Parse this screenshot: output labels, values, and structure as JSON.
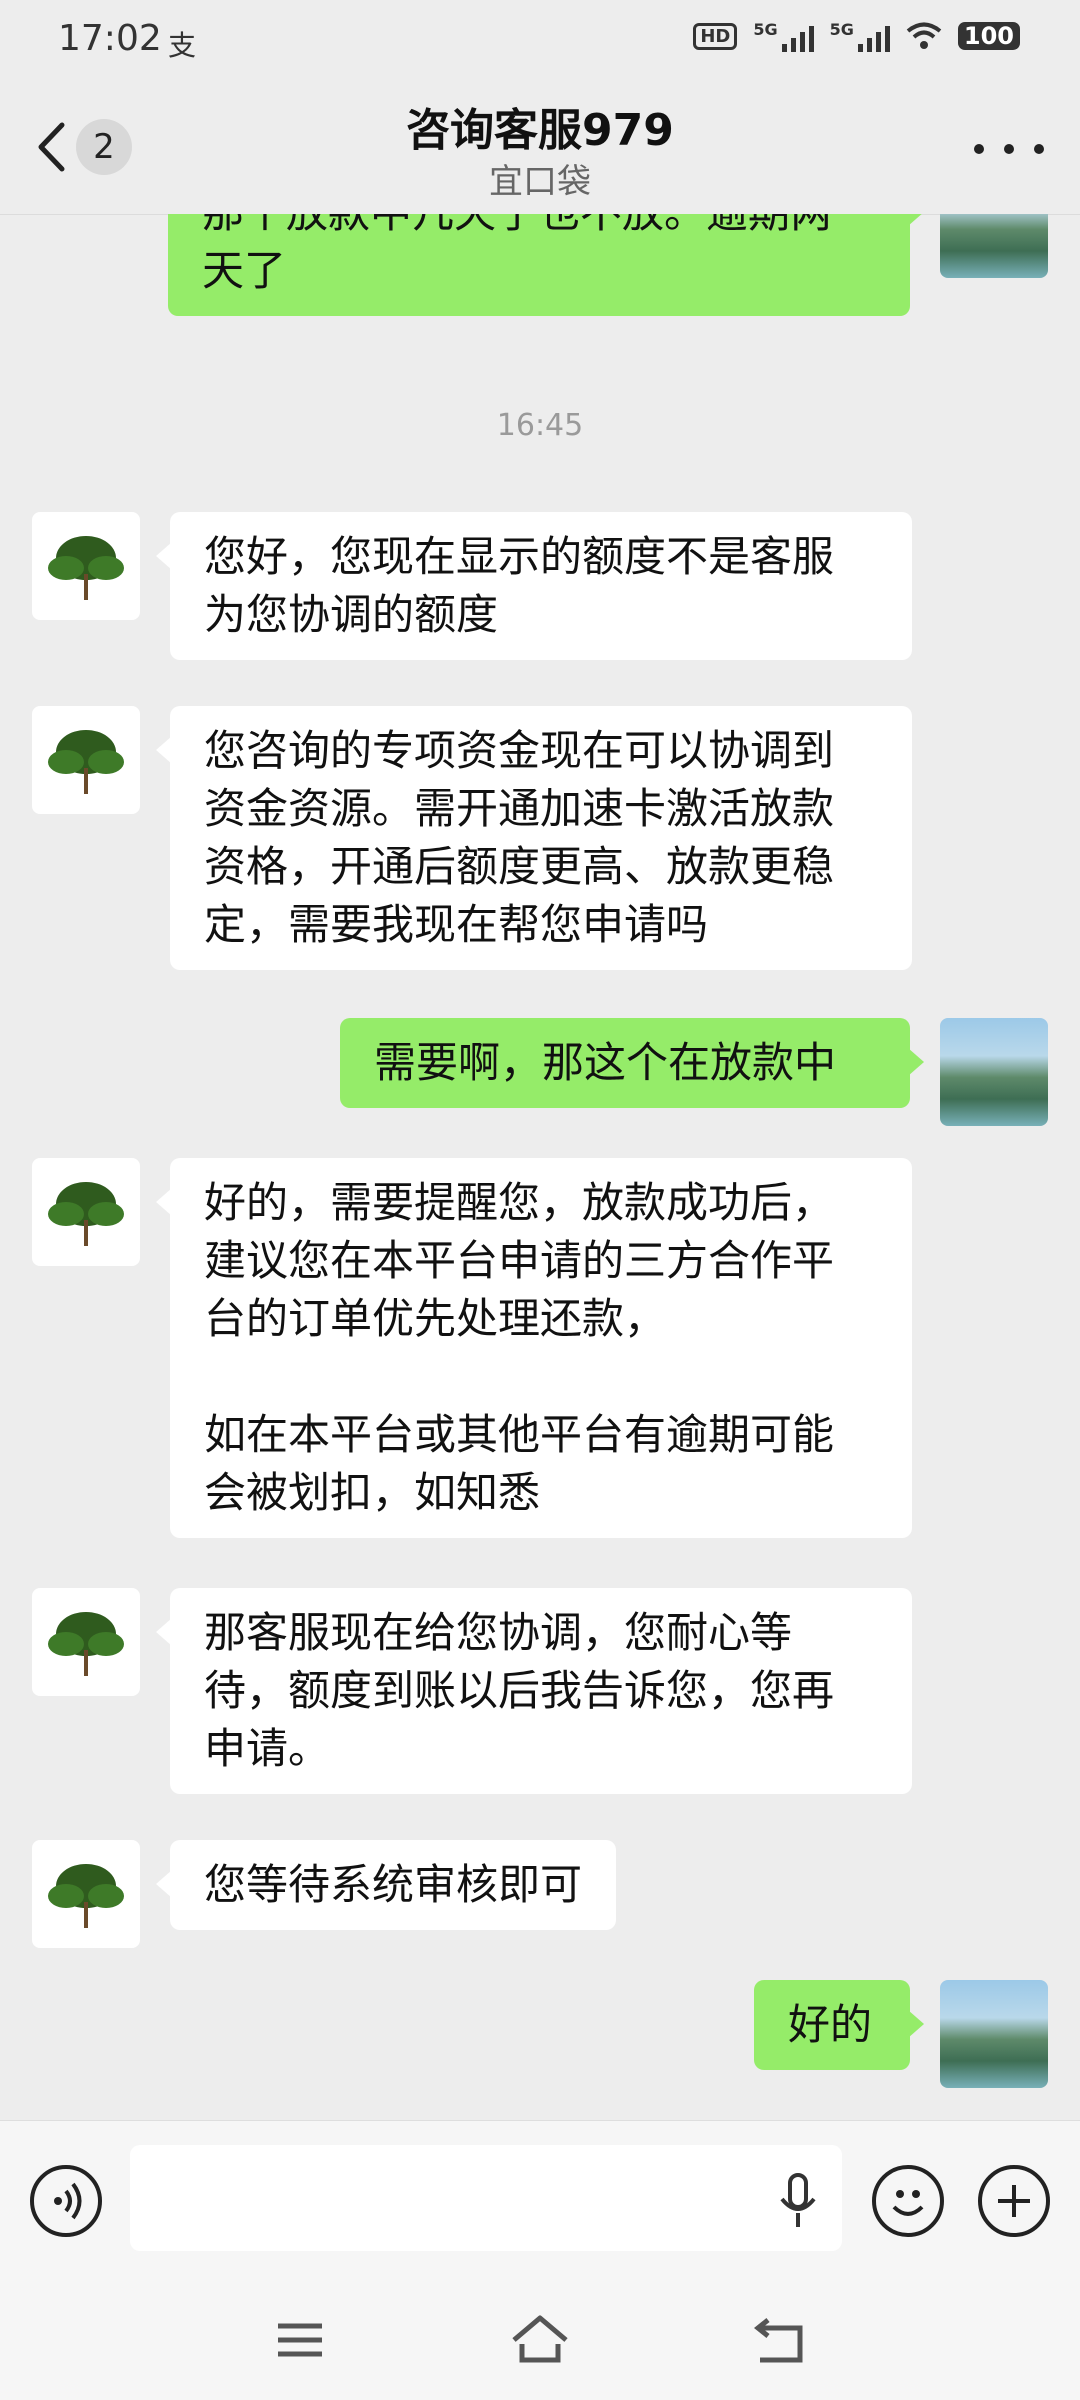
{
  "status_bar": {
    "time": "17:02",
    "alipay_glyph": "支",
    "hd": "HD",
    "sim1": "5G",
    "sim2": "5G",
    "battery": "100"
  },
  "header": {
    "unread_count": "2",
    "title": "咨询客服979",
    "subtitle": "宜口袋",
    "back_icon": "chevron-left-icon",
    "more_icon": "more-dots-icon"
  },
  "colors": {
    "background": "#ededed",
    "outgoing_bubble": "#95ec69",
    "incoming_bubble": "#ffffff",
    "timestamp_text": "#9a9a9a"
  },
  "messages": {
    "m0": "那个放款中几天了也不放。逾期两\n天了",
    "timestamp": "16:45",
    "m1": "您好，您现在显示的额度不是客服\n为您协调的额度",
    "m2": "您咨询的专项资金现在可以协调到\n资金资源。需开通加速卡激活放款\n资格，开通后额度更高、放款更稳\n定，需要我现在帮您申请吗",
    "m3": "需要啊，那这个在放款中",
    "m4": "好的，需要提醒您，放款成功后，\n建议您在本平台申请的三方合作平\n台的订单优先处理还款，\n\n如在本平台或其他平台有逾期可能\n会被划扣，如知悉",
    "m5": "那客服现在给您协调，您耐心等\n待，额度到账以后我告诉您，您再\n申请。",
    "m6": "您等待系统审核即可",
    "m7": "好的"
  },
  "input_bar": {
    "voice_icon": "voice-icon",
    "mic_icon": "microphone-icon",
    "emoji_icon": "emoji-icon",
    "plus_icon": "plus-icon"
  },
  "nav_bar": {
    "menu_icon": "menu-icon",
    "home_icon": "home-icon",
    "back_icon": "back-icon"
  }
}
